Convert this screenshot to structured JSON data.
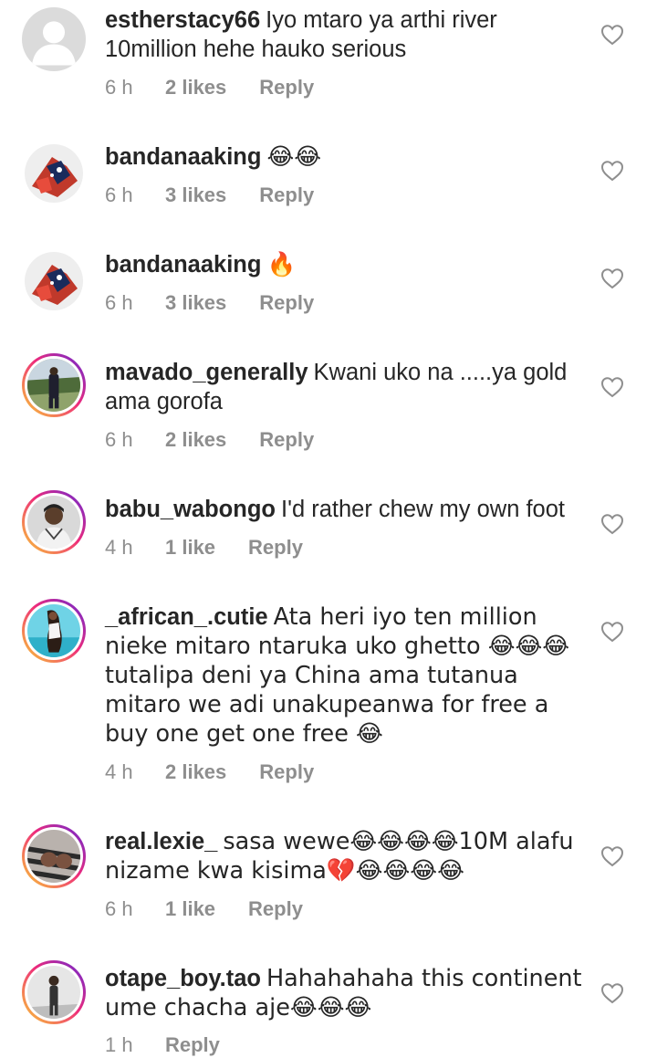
{
  "comments": [
    {
      "username": "estherstacy66",
      "text": "Iyo mtaro ya arthi river 10million hehe hauko serious",
      "time": "6 h",
      "likes": "2 likes",
      "reply": "Reply",
      "avatar_icon": "default-user-avatar"
    },
    {
      "username": "bandanaaking",
      "text": "😂😂",
      "time": "6 h",
      "likes": "3 likes",
      "reply": "Reply",
      "avatar_icon": "profile-photo"
    },
    {
      "username": "bandanaaking",
      "text": "🔥",
      "time": "6 h",
      "likes": "3 likes",
      "reply": "Reply",
      "avatar_icon": "profile-photo"
    },
    {
      "username": "mavado_generally",
      "text": "Kwani uko na .....ya gold ama gorofa",
      "time": "6 h",
      "likes": "2 likes",
      "reply": "Reply",
      "avatar_icon": "profile-photo"
    },
    {
      "username": "babu_wabongo",
      "text": "I'd rather chew my own foot",
      "time": "4 h",
      "likes": "1 like",
      "reply": "Reply",
      "avatar_icon": "profile-photo"
    },
    {
      "username": "_african_.cutie",
      "text": "Ata heri iyo ten million nieke mitaro ntaruka uko ghetto 😂😂😂 tutalipa deni ya China ama tutanua mitaro we adi unakupeanwa for free a buy one get one free 😂",
      "time": "4 h",
      "likes": "2 likes",
      "reply": "Reply",
      "avatar_icon": "profile-photo"
    },
    {
      "username": "real.lexie_",
      "text": "sasa wewe😂😂😂😂10M alafu nizame kwa kisima💔😂😂😂😂",
      "time": "6 h",
      "likes": "1 like",
      "reply": "Reply",
      "avatar_icon": "profile-photo"
    },
    {
      "username": "otape_boy.tao",
      "text": "Hahahahaha this continent ume chacha aje😂😂😂",
      "time": "1 h",
      "likes": "",
      "reply": "Reply",
      "avatar_icon": "profile-photo"
    }
  ],
  "like_icon": "heart-outline-icon",
  "colors": {
    "text": "#262626",
    "meta": "#8e8e8e",
    "story_ring_start": "#f9ce34",
    "story_ring_mid": "#ee2a7b",
    "story_ring_end": "#6228d7"
  }
}
